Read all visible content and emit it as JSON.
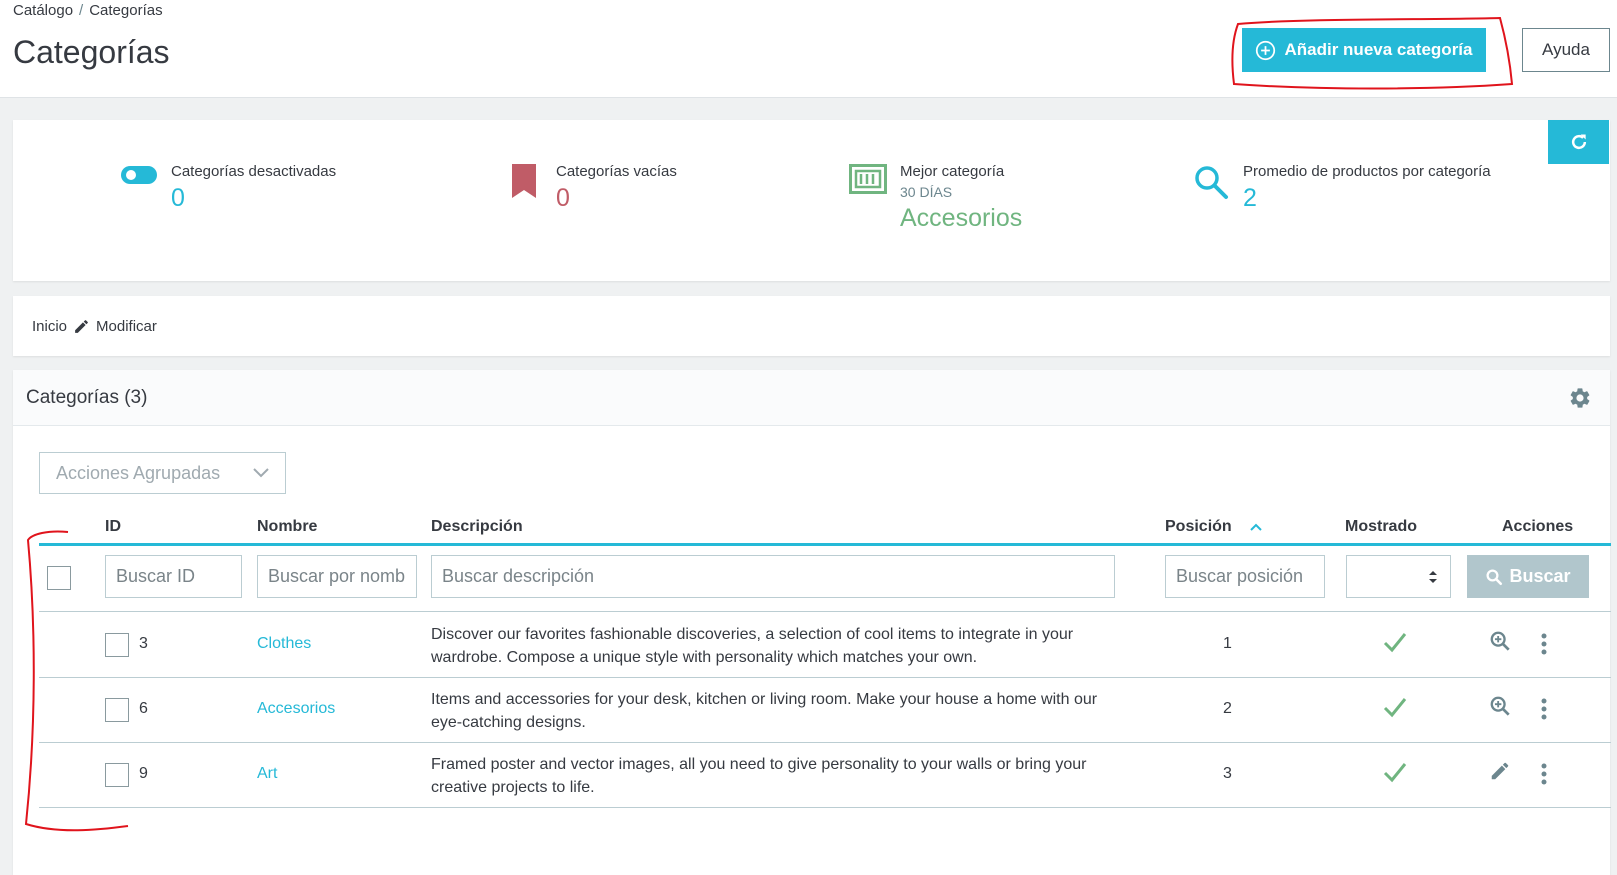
{
  "breadcrumb": {
    "parent": "Catálogo",
    "separator": "/",
    "current": "Categorías"
  },
  "header": {
    "title": "Categorías",
    "add_button": "Añadir nueva categoría",
    "help_button": "Ayuda"
  },
  "kpis": [
    {
      "label": "Categorías desactivadas",
      "sub": "",
      "value": "0",
      "icon": "toggle-icon",
      "color": "#25b9d7"
    },
    {
      "label": "Categorías vacías",
      "sub": "",
      "value": "0",
      "icon": "bookmark-icon",
      "color": "#c05c67"
    },
    {
      "label": "Mejor categoría",
      "sub": "30 DÍAS",
      "value": "Accesorios",
      "icon": "money-icon",
      "color": "#70b580"
    },
    {
      "label": "Promedio de productos por categoría",
      "sub": "",
      "value": "2",
      "icon": "search-icon",
      "color": "#25b9d7"
    }
  ],
  "category_breadcrumb": {
    "home": "Inicio",
    "edit": "Modificar"
  },
  "list": {
    "title": "Categorías (3)",
    "bulk_actions": "Acciones Agrupadas",
    "columns": {
      "id": "ID",
      "name": "Nombre",
      "description": "Descripción",
      "position": "Posición",
      "displayed": "Mostrado",
      "actions": "Acciones"
    },
    "filters": {
      "id_placeholder": "Buscar ID",
      "name_placeholder": "Buscar por nombre",
      "description_placeholder": "Buscar descripción",
      "position_placeholder": "Buscar posición",
      "search_button": "Buscar"
    },
    "rows": [
      {
        "id": "3",
        "name": "Clothes",
        "description": "Discover our favorites fashionable discoveries, a selection of cool items to integrate in your wardrobe. Compose a unique style with personality which matches your own.",
        "position": "1",
        "action": "view"
      },
      {
        "id": "6",
        "name": "Accesorios",
        "description": "Items and accessories for your desk, kitchen or living room. Make your house a home with our eye-catching designs.",
        "position": "2",
        "action": "view"
      },
      {
        "id": "9",
        "name": "Art",
        "description": "Framed poster and vector images, all you need to give personality to your walls or bring your creative projects to life.",
        "position": "3",
        "action": "edit"
      }
    ]
  },
  "colors": {
    "accent": "#25b9d7",
    "success": "#70b580",
    "danger": "#c05c67",
    "annotation": "#e0141c"
  }
}
